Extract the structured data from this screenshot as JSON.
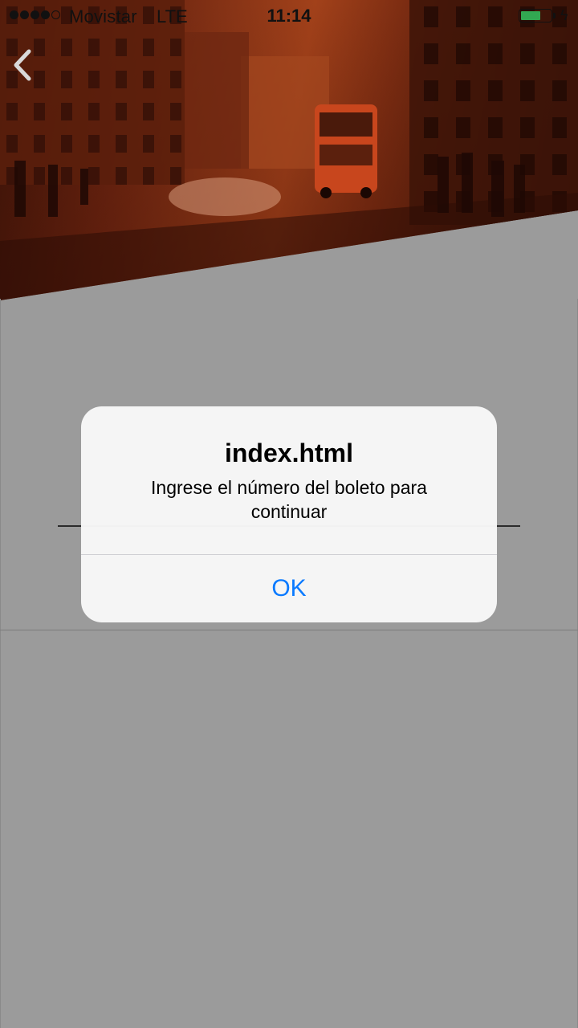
{
  "status_bar": {
    "carrier": "Movistar",
    "network": "LTE",
    "time": "11:14",
    "signal_bars": 4,
    "signal_total": 5,
    "battery_level": 0.7,
    "battery_color": "#32a852",
    "charge_icon": "charging-bolt-icon"
  },
  "header": {
    "back_icon": "chevron-left-icon",
    "photo_tint": "#8a3516"
  },
  "alert": {
    "title": "index.html",
    "message": "Ingrese el número del boleto para continuar",
    "ok_label": "OK",
    "ok_color": "#0a7aff"
  }
}
